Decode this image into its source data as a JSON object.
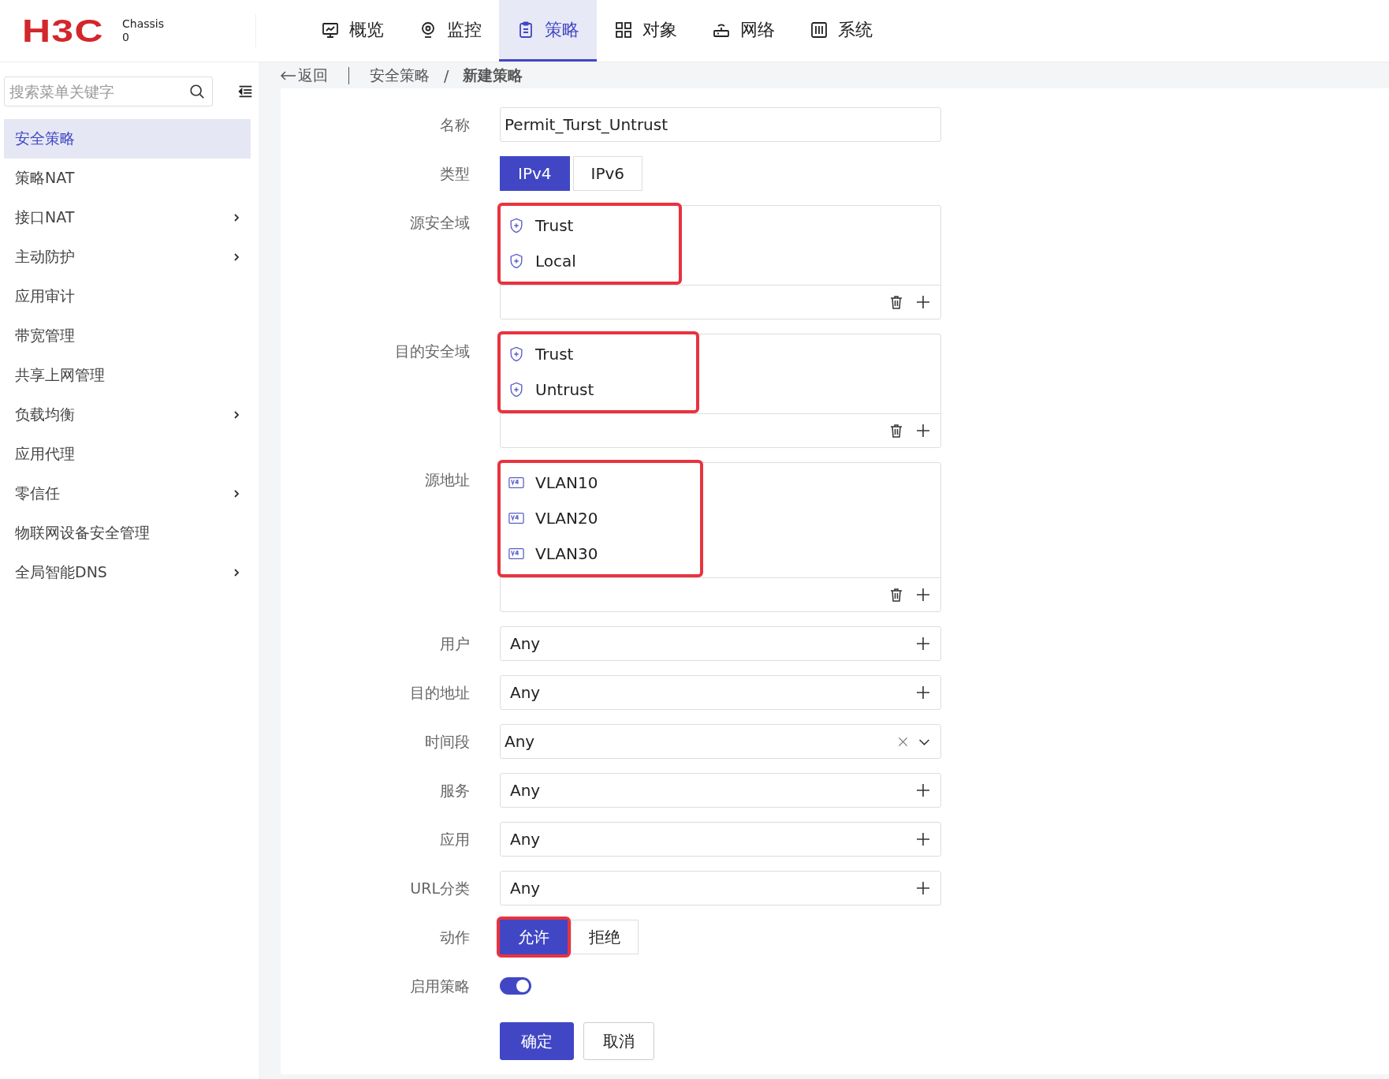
{
  "header": {
    "logo": "H3C",
    "chassis_label": "Chassis",
    "chassis_value": "0"
  },
  "nav_tabs": [
    {
      "label": "概览",
      "kind": "monitor",
      "selected": false
    },
    {
      "label": "监控",
      "kind": "pin",
      "selected": false
    },
    {
      "label": "策略",
      "kind": "clipboard",
      "selected": true
    },
    {
      "label": "对象",
      "kind": "grid",
      "selected": false
    },
    {
      "label": "网络",
      "kind": "router",
      "selected": false
    },
    {
      "label": "系统",
      "kind": "sliders",
      "selected": false
    }
  ],
  "sidebar": {
    "search_placeholder": "搜索菜单关键字",
    "items": [
      {
        "label": "安全策略",
        "selected": true,
        "expandable": false
      },
      {
        "label": "策略NAT",
        "selected": false,
        "expandable": false
      },
      {
        "label": "接口NAT",
        "selected": false,
        "expandable": true
      },
      {
        "label": "主动防护",
        "selected": false,
        "expandable": true
      },
      {
        "label": "应用审计",
        "selected": false,
        "expandable": false
      },
      {
        "label": "带宽管理",
        "selected": false,
        "expandable": false
      },
      {
        "label": "共享上网管理",
        "selected": false,
        "expandable": false
      },
      {
        "label": "负载均衡",
        "selected": false,
        "expandable": true
      },
      {
        "label": "应用代理",
        "selected": false,
        "expandable": false
      },
      {
        "label": "零信任",
        "selected": false,
        "expandable": true
      },
      {
        "label": "物联网设备安全管理",
        "selected": false,
        "expandable": false
      },
      {
        "label": "全局智能DNS",
        "selected": false,
        "expandable": true
      }
    ]
  },
  "breadcrumb": {
    "back": "返回",
    "items": [
      "安全策略",
      "新建策略"
    ],
    "separator": "/"
  },
  "form": {
    "rows": [
      {
        "label": "名称",
        "kind": "text",
        "value": "Permit_Turst_Untrust"
      },
      {
        "label": "类型",
        "kind": "segmented",
        "options": [
          {
            "label": "IPv4",
            "selected": true,
            "highlighted": false
          },
          {
            "label": "IPv6",
            "selected": false,
            "highlighted": false
          }
        ]
      },
      {
        "label": "源安全域",
        "kind": "list",
        "highlighted": true,
        "items": [
          {
            "label": "Trust",
            "kind": "zone"
          },
          {
            "label": "Local",
            "kind": "zone"
          }
        ]
      },
      {
        "label": "目的安全域",
        "kind": "list",
        "highlighted": true,
        "items": [
          {
            "label": "Trust",
            "kind": "zone"
          },
          {
            "label": "Untrust",
            "kind": "zone"
          }
        ]
      },
      {
        "label": "源地址",
        "kind": "list",
        "highlighted": true,
        "items": [
          {
            "label": "VLAN10",
            "kind": "address"
          },
          {
            "label": "VLAN20",
            "kind": "address"
          },
          {
            "label": "VLAN30",
            "kind": "address"
          }
        ]
      },
      {
        "label": "用户",
        "kind": "picker",
        "value": "Any"
      },
      {
        "label": "目的地址",
        "kind": "picker",
        "value": "Any"
      },
      {
        "label": "时间段",
        "kind": "dropdown",
        "value": "Any"
      },
      {
        "label": "服务",
        "kind": "picker",
        "value": "Any"
      },
      {
        "label": "应用",
        "kind": "picker",
        "value": "Any"
      },
      {
        "label": "URL分类",
        "kind": "picker",
        "value": "Any"
      },
      {
        "label": "动作",
        "kind": "segmented",
        "options": [
          {
            "label": "允许",
            "selected": true,
            "highlighted": true
          },
          {
            "label": "拒绝",
            "selected": false,
            "highlighted": false
          }
        ]
      },
      {
        "label": "启用策略",
        "kind": "toggle",
        "on": true
      }
    ],
    "buttons": [
      {
        "label": "确定",
        "kind": "primary"
      },
      {
        "label": "取消",
        "kind": "default"
      }
    ]
  }
}
